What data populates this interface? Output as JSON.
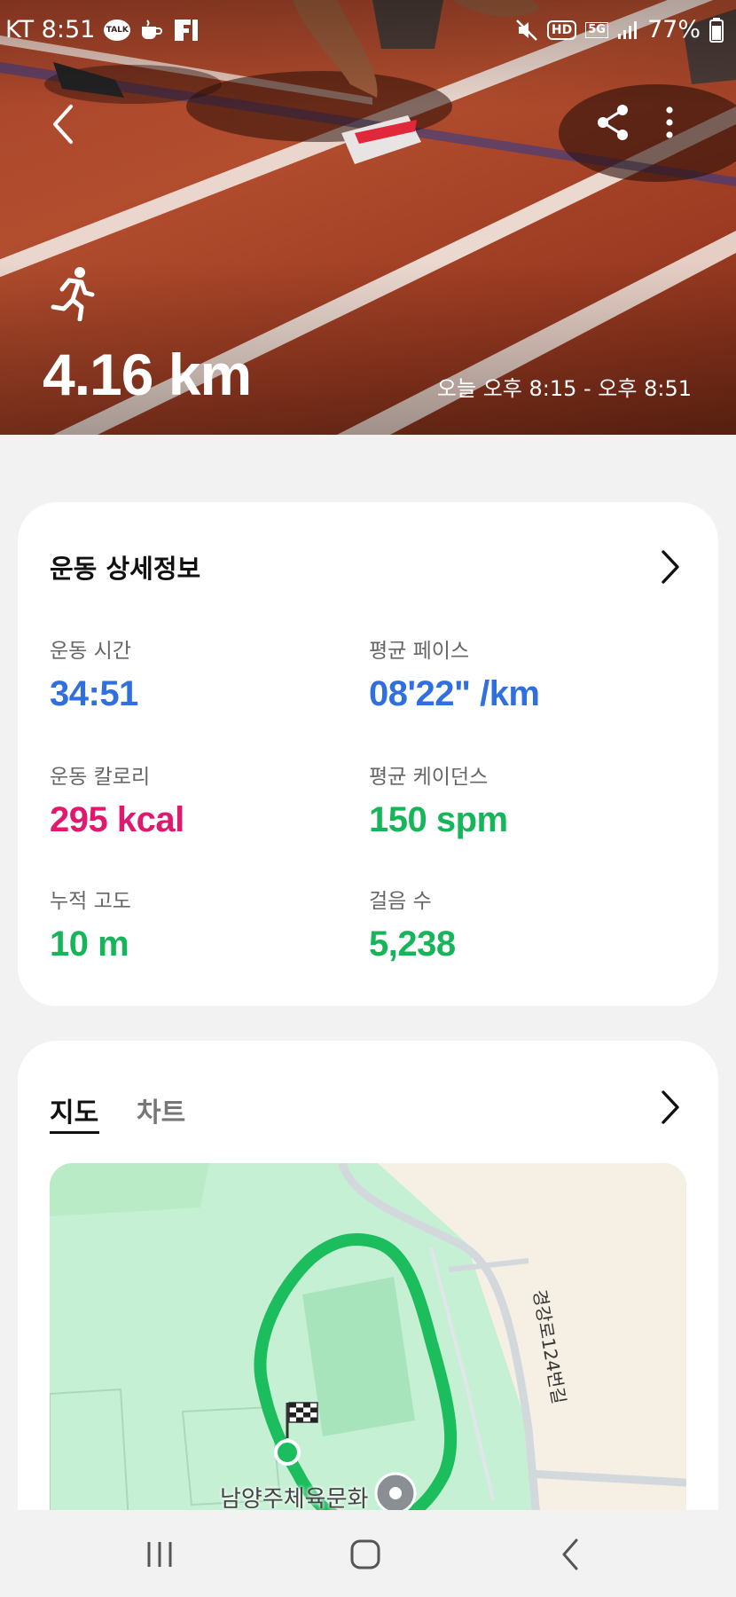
{
  "status_bar": {
    "carrier_time": "KT 8:51",
    "talk_badge": "TALK",
    "hd_label": "HD",
    "network_label": "5G",
    "battery": "77%"
  },
  "header": {
    "back_icon": "chevron-left-icon",
    "share_icon": "share-icon",
    "more_icon": "more-vertical-icon"
  },
  "workout": {
    "activity_icon": "running-person-icon",
    "distance": "4.16 km",
    "time_range": "오늘 오후 8:15 - 오후 8:51"
  },
  "details": {
    "title": "운동 상세정보",
    "metrics": [
      {
        "label": "운동 시간",
        "value": "34:51",
        "color": "#2f6fe0"
      },
      {
        "label": "평균 페이스",
        "value": "08'22\" /km",
        "color": "#2f6fe0"
      },
      {
        "label": "운동 칼로리",
        "value": "295 kcal",
        "color": "#e0186e"
      },
      {
        "label": "평균 케이던스",
        "value": "150 spm",
        "color": "#17b55a"
      },
      {
        "label": "누적 고도",
        "value": "10 m",
        "color": "#17b55a"
      },
      {
        "label": "걸음 수",
        "value": "5,238",
        "color": "#17b55a"
      }
    ]
  },
  "map_card": {
    "tabs": [
      {
        "label": "지도",
        "active": true
      },
      {
        "label": "차트",
        "active": false
      }
    ],
    "road_label": "경강로124번길",
    "place_label": "남양주체육문화"
  },
  "bottom_nav": {
    "recents_icon": "recents-icon",
    "home_icon": "home-icon",
    "back_icon": "back-icon"
  }
}
